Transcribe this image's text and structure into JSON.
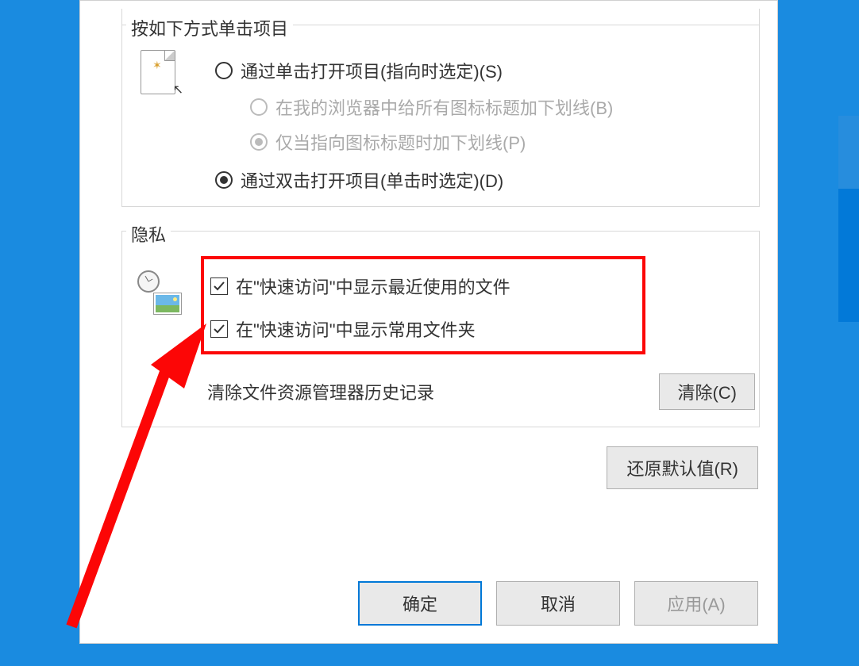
{
  "click_group": {
    "label": "按如下方式单击项目",
    "radio1": "通过单击打开项目(指向时选定)(S)",
    "sub1": "在我的浏览器中给所有图标标题加下划线(B)",
    "sub2": "仅当指向图标标题时加下划线(P)",
    "radio2": "通过双击打开项目(单击时选定)(D)"
  },
  "privacy_group": {
    "label": "隐私",
    "check1": "在\"快速访问\"中显示最近使用的文件",
    "check2": "在\"快速访问\"中显示常用文件夹",
    "clear_label": "清除文件资源管理器历史记录",
    "clear_button": "清除(C)"
  },
  "restore_button": "还原默认值(R)",
  "ok_button": "确定",
  "cancel_button": "取消",
  "apply_button": "应用(A)"
}
